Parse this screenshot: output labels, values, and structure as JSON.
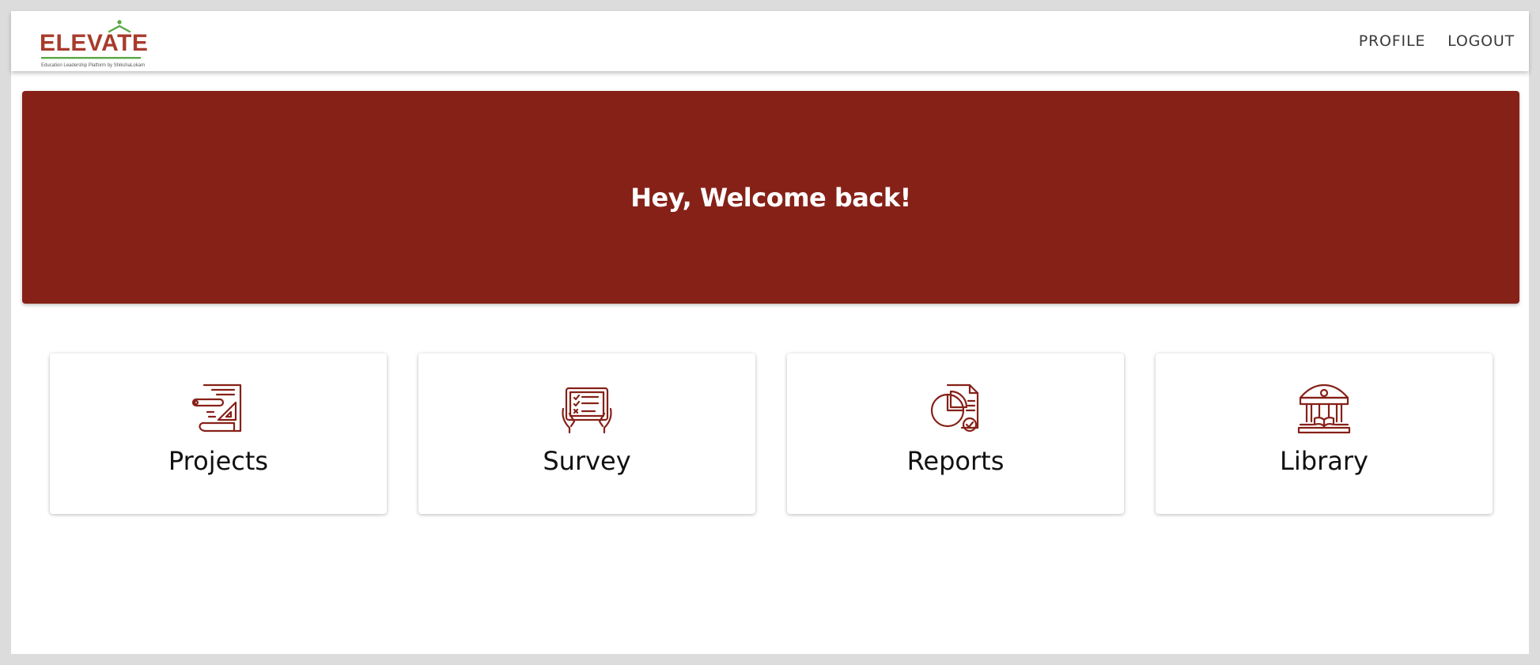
{
  "brand": {
    "logo_text": "ELEVATE",
    "tagline": "Education Leadership Platform by ShikshaLokam",
    "colors": {
      "logo_red": "#a83b2c",
      "logo_green": "#5aa844"
    }
  },
  "nav": {
    "profile_label": "PROFILE",
    "logout_label": "LOGOUT"
  },
  "banner": {
    "title": "Hey, Welcome back!",
    "background": "#862118"
  },
  "cards": [
    {
      "label": "Projects",
      "icon": "projects-icon"
    },
    {
      "label": "Survey",
      "icon": "survey-icon"
    },
    {
      "label": "Reports",
      "icon": "reports-icon"
    },
    {
      "label": "Library",
      "icon": "library-icon"
    }
  ],
  "theme": {
    "accent": "#862118",
    "icon_color": "#862118",
    "page_bg": "#ffffff",
    "outer_bg": "#dcdcdc"
  }
}
